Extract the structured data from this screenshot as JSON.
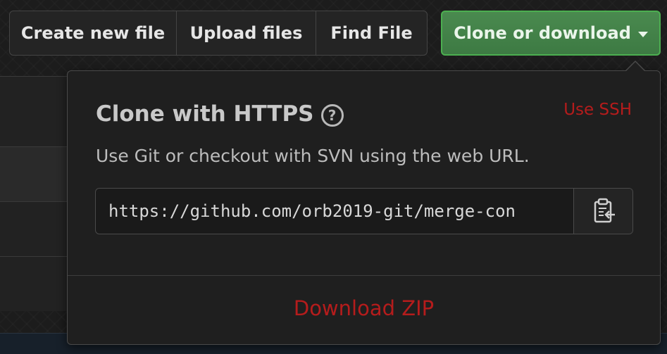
{
  "toolbar": {
    "create_new_file": "Create new file",
    "upload_files": "Upload files",
    "find_file": "Find File",
    "clone_or_download": "Clone or download"
  },
  "clone_popover": {
    "title": "Clone with HTTPS",
    "help_icon": "question-circle-icon",
    "use_ssh": "Use SSH",
    "description": "Use Git or checkout with SVN using the web URL.",
    "clone_url": "https://github.com/orb2019-git/merge-con",
    "copy_icon": "clipboard-icon",
    "download_zip": "Download ZIP"
  },
  "colors": {
    "accent_green": "#3d7a43",
    "link_red": "#b51c1c"
  }
}
